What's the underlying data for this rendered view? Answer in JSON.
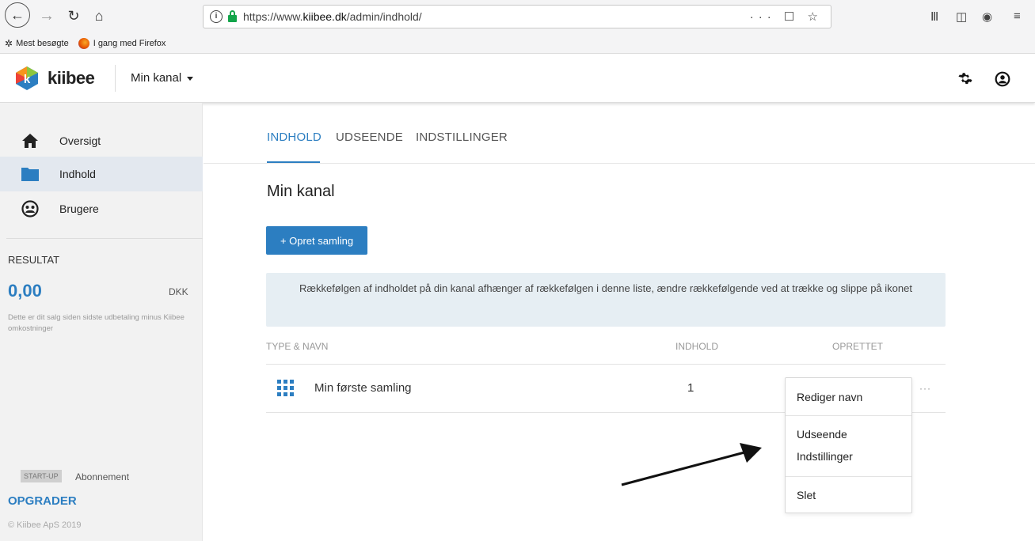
{
  "browser": {
    "url_prefix": "https://www.",
    "url_domain": "kiibee.dk",
    "url_path": "/admin/indhold/",
    "url_actions": "··· ☐ ☆",
    "bookmarks": [
      {
        "label": "Mest besøgte",
        "icon": "gear-star-icon"
      },
      {
        "label": "I gang med Firefox",
        "icon": "firefox-icon"
      }
    ]
  },
  "header": {
    "brand": "kiibee",
    "channel": "Min kanal"
  },
  "sidebar": {
    "items": [
      {
        "label": "Oversigt",
        "icon": "home-icon"
      },
      {
        "label": "Indhold",
        "icon": "folder-icon",
        "active": true
      },
      {
        "label": "Brugere",
        "icon": "users-icon"
      }
    ],
    "result_title": "RESULTAT",
    "result_value": "0,00",
    "result_currency": "DKK",
    "result_desc": "Dette er dit salg siden sidste udbetaling minus Kiibee omkostninger",
    "plan_badge": "START-UP",
    "plan_label": "Abonnement",
    "upgrade": "OPGRADER",
    "copyright": "© Kiibee ApS 2019"
  },
  "tabs": [
    {
      "label": "INDHOLD",
      "active": true
    },
    {
      "label": "UDSEENDE"
    },
    {
      "label": "INDSTILLINGER"
    }
  ],
  "main": {
    "title": "Min kanal",
    "create_button": "+ Opret samling",
    "info": "Rækkefølgen af indholdet på din kanal afhænger af rækkefølgen i denne liste, ændre rækkefølgende ved at trække og slippe på ikonet",
    "columns": [
      "TYPE & NAVN",
      "INDHOLD",
      "OPRETTET"
    ],
    "rows": [
      {
        "name": "Min første samling",
        "count": "1"
      }
    ],
    "more": "···"
  },
  "dropdown": {
    "items": [
      "Rediger navn",
      "Udseende",
      "Indstillinger",
      "Slet"
    ]
  },
  "colors": {
    "accent": "#2c7ec1",
    "info_bg": "#e6eef3",
    "sidebar_bg": "#f2f2f2",
    "sidebar_active": "#e3e8ef"
  }
}
